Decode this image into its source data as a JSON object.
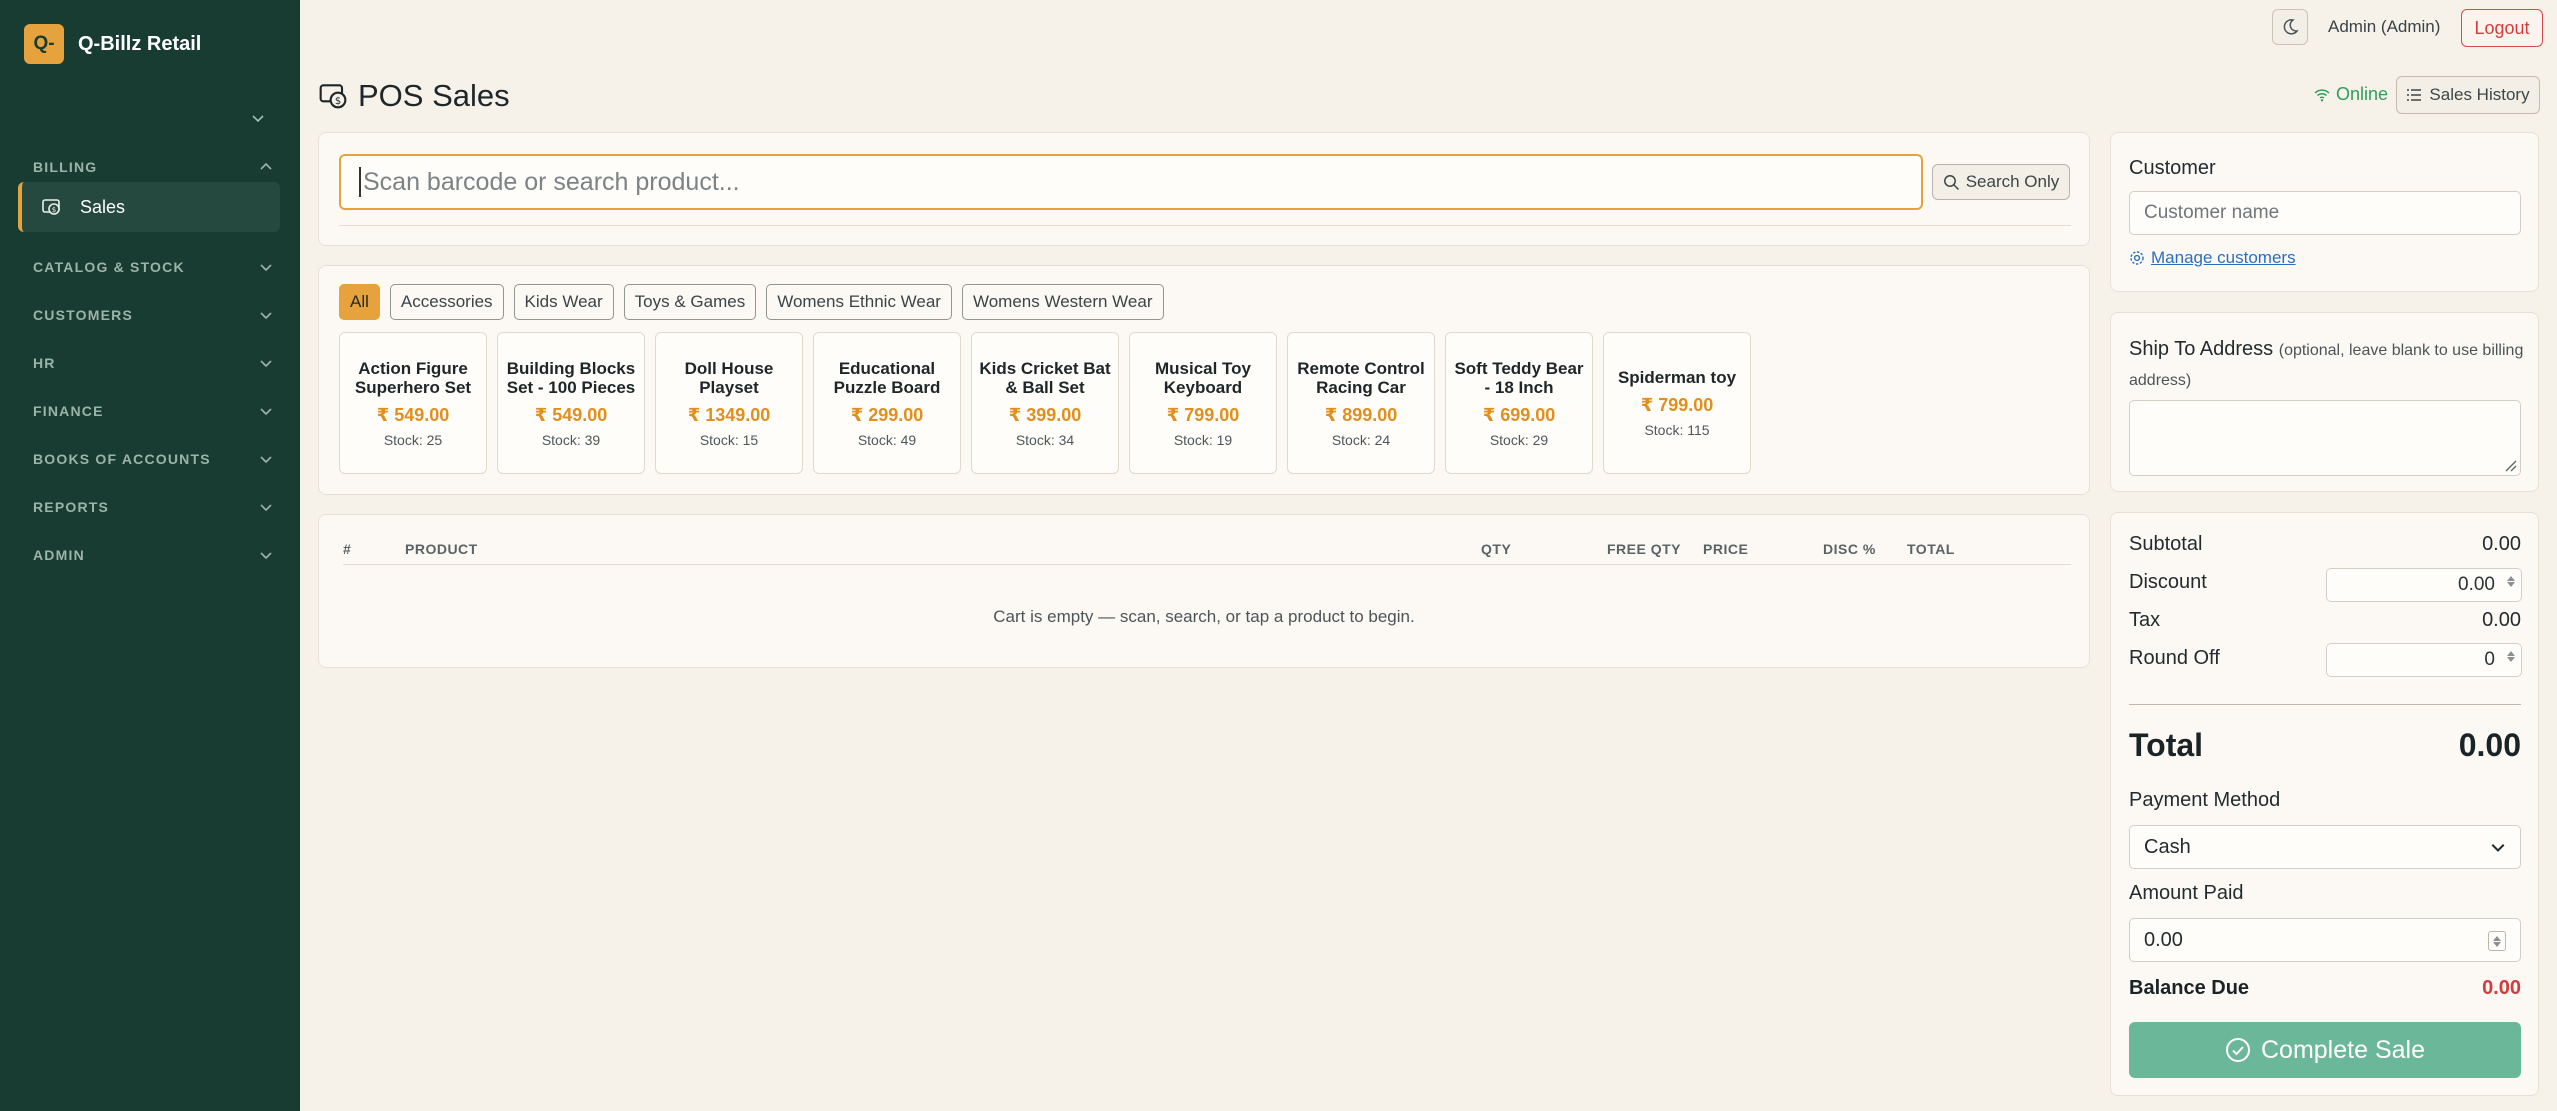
{
  "app": {
    "logo_text": "Q-",
    "name": "Q-Billz Retail"
  },
  "sidebar": {
    "sections": [
      {
        "label": "BILLING",
        "expanded": true
      },
      {
        "label": "CATALOG & STOCK",
        "expanded": false
      },
      {
        "label": "CUSTOMERS",
        "expanded": false
      },
      {
        "label": "HR",
        "expanded": false
      },
      {
        "label": "FINANCE",
        "expanded": false
      },
      {
        "label": "BOOKS OF ACCOUNTS",
        "expanded": false
      },
      {
        "label": "REPORTS",
        "expanded": false
      },
      {
        "label": "ADMIN",
        "expanded": false
      }
    ],
    "active_item": {
      "label": "Sales",
      "icon": "cash-register-icon"
    }
  },
  "topbar": {
    "user": "Admin (Admin)",
    "logout_label": "Logout"
  },
  "page": {
    "title": "POS Sales",
    "status": "Online",
    "sales_history_label": "Sales History"
  },
  "search": {
    "placeholder": "Scan barcode or search product...",
    "search_only_label": "Search Only"
  },
  "categories": [
    {
      "label": "All",
      "active": true
    },
    {
      "label": "Accessories",
      "active": false
    },
    {
      "label": "Kids Wear",
      "active": false
    },
    {
      "label": "Toys & Games",
      "active": false
    },
    {
      "label": "Womens Ethnic Wear",
      "active": false
    },
    {
      "label": "Womens Western Wear",
      "active": false
    }
  ],
  "products": [
    {
      "name": "Action Figure Superhero Set",
      "price": "₹ 549.00",
      "stock": "Stock: 25"
    },
    {
      "name": "Building Blocks Set - 100 Pieces",
      "price": "₹ 549.00",
      "stock": "Stock: 39"
    },
    {
      "name": "Doll House Playset",
      "price": "₹ 1349.00",
      "stock": "Stock: 15"
    },
    {
      "name": "Educational Puzzle Board",
      "price": "₹ 299.00",
      "stock": "Stock: 49"
    },
    {
      "name": "Kids Cricket Bat & Ball Set",
      "price": "₹ 399.00",
      "stock": "Stock: 34"
    },
    {
      "name": "Musical Toy Keyboard",
      "price": "₹ 799.00",
      "stock": "Stock: 19"
    },
    {
      "name": "Remote Control Racing Car",
      "price": "₹ 899.00",
      "stock": "Stock: 24"
    },
    {
      "name": "Soft Teddy Bear - 18 Inch",
      "price": "₹ 699.00",
      "stock": "Stock: 29"
    },
    {
      "name": "Spiderman toy",
      "price": "₹ 799.00",
      "stock": "Stock: 115"
    }
  ],
  "cart": {
    "columns": {
      "num": "#",
      "product": "PRODUCT",
      "qty": "QTY",
      "free_qty": "FREE QTY",
      "price": "PRICE",
      "disc": "DISC %",
      "total": "TOTAL"
    },
    "empty_message": "Cart is empty — scan, search, or tap a product to begin."
  },
  "customer": {
    "label": "Customer",
    "placeholder": "Customer name",
    "manage_label": "Manage customers"
  },
  "ship": {
    "label": "Ship To Address",
    "hint": "(optional, leave blank to use billing address)"
  },
  "summary": {
    "subtotal_label": "Subtotal",
    "subtotal": "0.00",
    "discount_label": "Discount",
    "discount": "0.00",
    "tax_label": "Tax",
    "tax": "0.00",
    "roundoff_label": "Round Off",
    "roundoff": "0",
    "total_label": "Total",
    "total": "0.00",
    "payment_label": "Payment Method",
    "payment_method": "Cash",
    "amount_paid_label": "Amount Paid",
    "amount_paid": "0.00",
    "balance_label": "Balance Due",
    "balance": "0.00",
    "complete_label": "Complete Sale"
  },
  "colors": {
    "sidebar": "#183c32",
    "accent": "#e6a23c",
    "online": "#2e9e5b",
    "danger": "#d23c3c",
    "complete": "#6bb79a"
  }
}
